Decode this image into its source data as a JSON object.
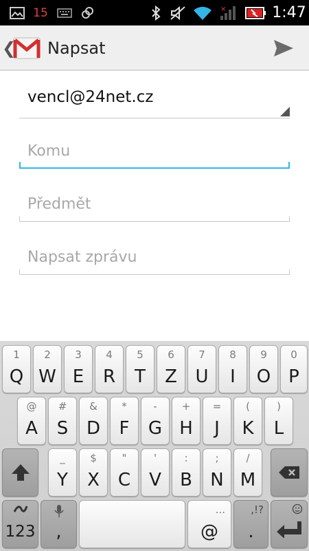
{
  "status_bar": {
    "notification_count": "15",
    "clock": "1:47",
    "icons": [
      "image-icon",
      "keyboard-icon",
      "sync-icon",
      "bluetooth-icon",
      "mute-icon",
      "wifi-icon",
      "signal-icon",
      "battery-icon"
    ]
  },
  "action_bar": {
    "title": "Napsat",
    "back_glyph": "❮",
    "app_icon": "gmail-icon",
    "send_icon": "send-icon"
  },
  "compose": {
    "from": "vencl@24net.cz",
    "to_placeholder": "Komu",
    "subject_placeholder": "Předmět",
    "body_placeholder": "Napsat zprávu"
  },
  "keyboard": {
    "row1": [
      {
        "main": "Q",
        "alt": "1"
      },
      {
        "main": "W",
        "alt": "2"
      },
      {
        "main": "E",
        "alt": "3"
      },
      {
        "main": "R",
        "alt": "4"
      },
      {
        "main": "T",
        "alt": "5"
      },
      {
        "main": "Z",
        "alt": "6"
      },
      {
        "main": "U",
        "alt": "7"
      },
      {
        "main": "I",
        "alt": "8"
      },
      {
        "main": "O",
        "alt": "9"
      },
      {
        "main": "P",
        "alt": "0"
      }
    ],
    "row2": [
      {
        "main": "A",
        "alt": "@"
      },
      {
        "main": "S",
        "alt": "#"
      },
      {
        "main": "D",
        "alt": "&"
      },
      {
        "main": "F",
        "alt": "*"
      },
      {
        "main": "G",
        "alt": "-"
      },
      {
        "main": "H",
        "alt": "+"
      },
      {
        "main": "J",
        "alt": "="
      },
      {
        "main": "K",
        "alt": "("
      },
      {
        "main": "L",
        "alt": ")"
      }
    ],
    "row3": [
      {
        "main": "Y",
        "alt": "_"
      },
      {
        "main": "X",
        "alt": "$"
      },
      {
        "main": "C",
        "alt": "\""
      },
      {
        "main": "V",
        "alt": "'"
      },
      {
        "main": "B",
        "alt": ":"
      },
      {
        "main": "N",
        "alt": ";"
      },
      {
        "main": "M",
        "alt": "/"
      }
    ],
    "symbols_key": "123",
    "comma_key": ",",
    "at_key": "@",
    "at_alt": "...",
    "period_key": ".",
    "period_alt": ",!?"
  }
}
